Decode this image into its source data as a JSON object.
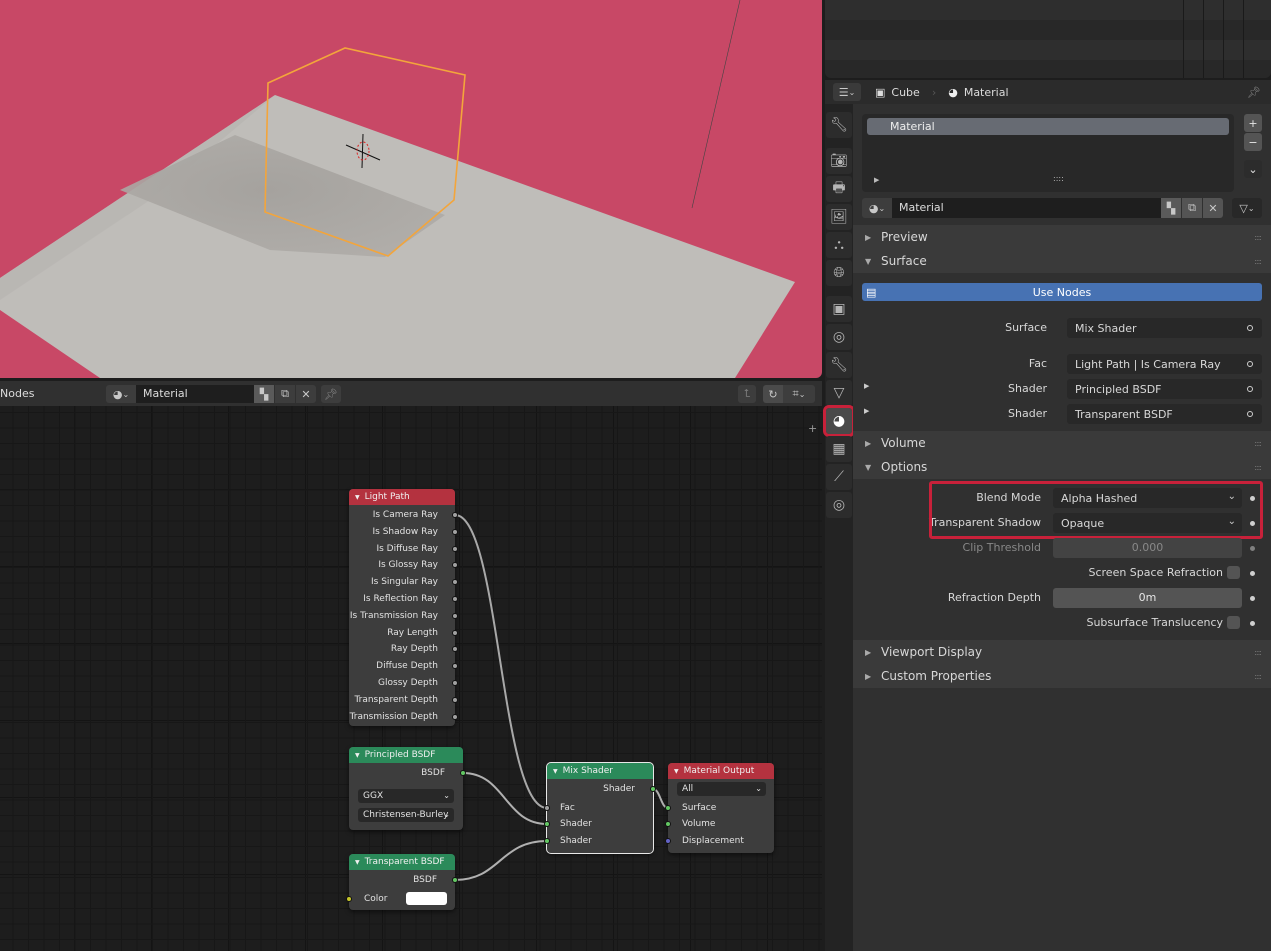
{
  "viewport": {
    "background_color": "#c84866",
    "floor_color": "#bfbdb9",
    "selection_outline_color": "#f3a53b"
  },
  "node_editor": {
    "editor_label": "Nodes",
    "material_name": "Material",
    "icons": [
      "material-sphere-icon",
      "new-material-icon",
      "duplicate-icon",
      "unlink-x-icon",
      "pin-icon",
      "parent-up-icon",
      "snap-magnet-icon",
      "snap-grid-icon"
    ],
    "nodes": {
      "light_path": {
        "title": "Light Path",
        "header_color": "#b4323f",
        "outputs": [
          "Is Camera Ray",
          "Is Shadow Ray",
          "Is Diffuse Ray",
          "Is Glossy Ray",
          "Is Singular Ray",
          "Is Reflection Ray",
          "Is Transmission Ray",
          "Ray Length",
          "Ray Depth",
          "Diffuse Depth",
          "Glossy Depth",
          "Transparent Depth",
          "Transmission Depth"
        ]
      },
      "principled": {
        "title": "Principled BSDF",
        "header_color": "#2b8a5a",
        "output": "BSDF",
        "distribution": "GGX",
        "subsurface_method": "Christensen-Burley"
      },
      "transparent": {
        "title": "Transparent BSDF",
        "header_color": "#2b8a5a",
        "output": "BSDF",
        "input_color_label": "Color",
        "color_value": "#ffffff"
      },
      "mix_shader": {
        "title": "Mix Shader",
        "header_color": "#2b8a5a",
        "output": "Shader",
        "inputs": [
          "Fac",
          "Shader",
          "Shader"
        ]
      },
      "material_output": {
        "title": "Material Output",
        "header_color": "#b4323f",
        "target": "All",
        "inputs": [
          "Surface",
          "Volume",
          "Displacement"
        ]
      }
    }
  },
  "properties": {
    "breadcrumb": {
      "object": "Cube",
      "material": "Material"
    },
    "tabs": [
      "tool",
      "render",
      "output",
      "view-layer",
      "scene",
      "world",
      "object",
      "modifiers",
      "particles",
      "physics",
      "object-data",
      "material",
      "texture",
      "constraints",
      "shader-fx"
    ],
    "active_tab": "material",
    "material_slots": [
      "Material"
    ],
    "material_name": "Material",
    "panels": {
      "preview": "Preview",
      "surface": "Surface",
      "volume": "Volume",
      "options": "Options",
      "viewport_display": "Viewport Display",
      "custom_properties": "Custom Properties"
    },
    "use_nodes_label": "Use Nodes",
    "surface": {
      "surface_label": "Surface",
      "surface_value": "Mix Shader",
      "fac_label": "Fac",
      "fac_value": "Light Path | Is Camera Ray",
      "shader1_label": "Shader",
      "shader1_value": "Principled BSDF",
      "shader2_label": "Shader",
      "shader2_value": "Transparent BSDF"
    },
    "options": {
      "blend_mode_label": "Blend Mode",
      "blend_mode_value": "Alpha Hashed",
      "transparent_shadow_label": "Transparent Shadow",
      "transparent_shadow_value": "Opaque",
      "clip_threshold_label": "Clip Threshold",
      "clip_threshold_value": "0.000",
      "ssr_label": "Screen Space Refraction",
      "ssr_checked": false,
      "refraction_depth_label": "Refraction Depth",
      "refraction_depth_value": "0m",
      "subsurface_translucency_label": "Subsurface Translucency",
      "subsurface_translucency_checked": false
    },
    "highlight_color": "#c8213a",
    "accent_color": "#4772b3"
  }
}
